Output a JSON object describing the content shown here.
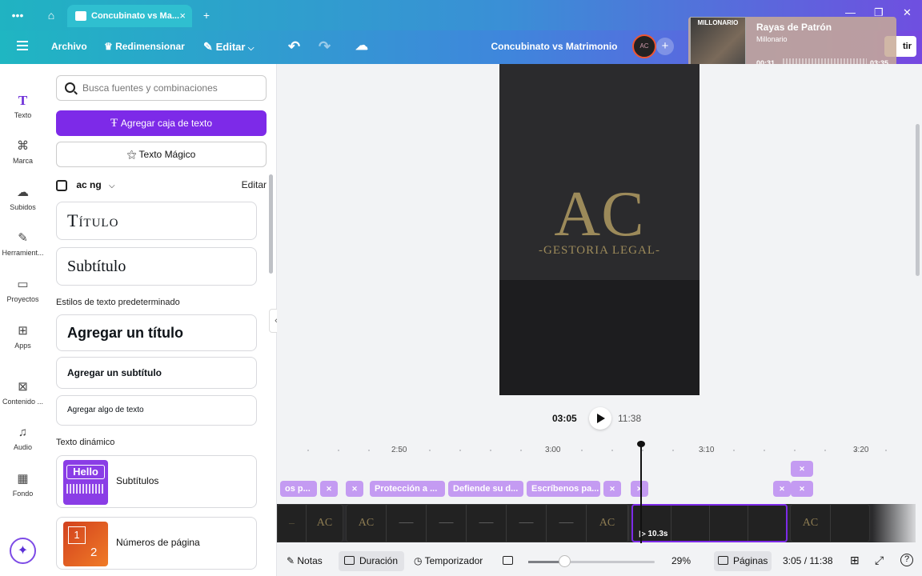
{
  "browser": {
    "tab_title": "Concubinato vs Ma...",
    "new_tab_icon": "plus-icon"
  },
  "header": {
    "archivo": "Archivo",
    "redimensionar": "Redimensionar",
    "editar": "Editar",
    "doc_title": "Concubinato vs Matrimonio",
    "avatar_text": "AC",
    "compartir": "tir"
  },
  "music": {
    "cover_text": "MILLONARIO",
    "song": "Rayas de Patrón",
    "artist": "Millonario",
    "elapsed": "00:31",
    "duration": "03:35",
    "progress": 0.144
  },
  "rail": {
    "items": [
      {
        "label": "Texto",
        "icon": "T"
      },
      {
        "label": "Marca",
        "icon": "brand-icon"
      },
      {
        "label": "Subidos",
        "icon": "cloud-icon"
      },
      {
        "label": "Herramient...",
        "icon": "pen-icon"
      },
      {
        "label": "Proyectos",
        "icon": "folder-icon"
      },
      {
        "label": "Apps",
        "icon": "apps-icon"
      },
      {
        "label": "Contenido ...",
        "icon": "content-icon"
      },
      {
        "label": "Audio",
        "icon": "music-icon"
      },
      {
        "label": "Fondo",
        "icon": "pattern-icon"
      }
    ]
  },
  "panel": {
    "search_placeholder": "Busca fuentes y combinaciones",
    "add_textbox": "Agregar caja de texto",
    "magic_text": "Texto Mágico",
    "brand_kit": "ac ng",
    "brand_edit": "Editar",
    "titulo": "Título",
    "subtitulo": "Subtítulo",
    "default_styles": "Estilos de texto predeterminado",
    "add_title": "Agregar un título",
    "add_subtitle": "Agregar un subtítulo",
    "add_body": "Agregar algo de texto",
    "dynamic_text": "Texto dinámico",
    "subtitulos": "Subtítulos",
    "subtitulos_thumb": "Hello",
    "page_numbers": "Números de página",
    "page_numbers_thumb_a": "1",
    "page_numbers_thumb_b": "2"
  },
  "canvas": {
    "logo": "AC",
    "tagline": "-GESTORIA LEGAL-"
  },
  "playback": {
    "current": "03:05",
    "total": "11:38"
  },
  "timeline": {
    "ticks": [
      "2:50",
      "3:00",
      "3:10",
      "3:20"
    ],
    "captions": [
      "os p...",
      "Protección a ...",
      "Defiende su d...",
      "Escríbenos pa..."
    ],
    "selected_clip_duration": "10.3s"
  },
  "footer": {
    "notas": "Notas",
    "duracion": "Duración",
    "temporizador": "Temporizador",
    "zoom": "29%",
    "paginas": "Páginas",
    "time_display": "3:05 / 11:38"
  },
  "colors": {
    "accent": "#7d2ae8",
    "header_start": "#1fb6c2",
    "header_end": "#7648e0",
    "logo_gold": "#9c8a5a"
  }
}
